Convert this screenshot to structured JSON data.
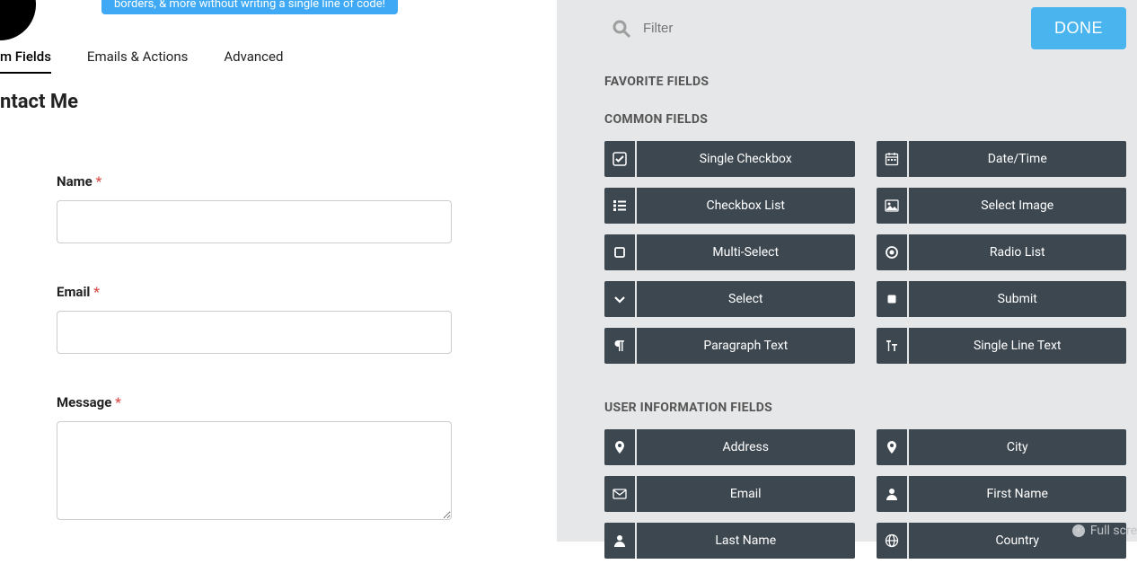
{
  "banner": "borders, & more without writing a single line of code!",
  "tabs": {
    "form_fields": "m Fields",
    "emails_actions": "Emails & Actions",
    "advanced": "Advanced"
  },
  "page_title": "ntact Me",
  "form": {
    "name_label": "Name",
    "email_label": "Email",
    "message_label": "Message",
    "name_value": "",
    "email_value": "",
    "message_value": ""
  },
  "required_marker": "*",
  "search": {
    "placeholder": "Filter"
  },
  "done_label": "DONE",
  "sections": {
    "favorite": "FAVORITE FIELDS",
    "common": "COMMON FIELDS",
    "userinfo": "USER INFORMATION FIELDS"
  },
  "common_fields": [
    {
      "label": "Single Checkbox",
      "icon": "check-square"
    },
    {
      "label": "Date/Time",
      "icon": "calendar"
    },
    {
      "label": "Checkbox List",
      "icon": "list"
    },
    {
      "label": "Select Image",
      "icon": "image"
    },
    {
      "label": "Multi-Select",
      "icon": "square"
    },
    {
      "label": "Radio List",
      "icon": "radio"
    },
    {
      "label": "Select",
      "icon": "chevron-down"
    },
    {
      "label": "Submit",
      "icon": "square-filled"
    },
    {
      "label": "Paragraph Text",
      "icon": "paragraph"
    },
    {
      "label": "Single Line Text",
      "icon": "text"
    }
  ],
  "userinfo_fields": [
    {
      "label": "Address",
      "icon": "pin"
    },
    {
      "label": "City",
      "icon": "pin"
    },
    {
      "label": "Email",
      "icon": "envelope"
    },
    {
      "label": "First Name",
      "icon": "user"
    },
    {
      "label": "Last Name",
      "icon": "user"
    },
    {
      "label": "Country",
      "icon": "globe"
    }
  ],
  "fullscreen_hint": "Full scre"
}
